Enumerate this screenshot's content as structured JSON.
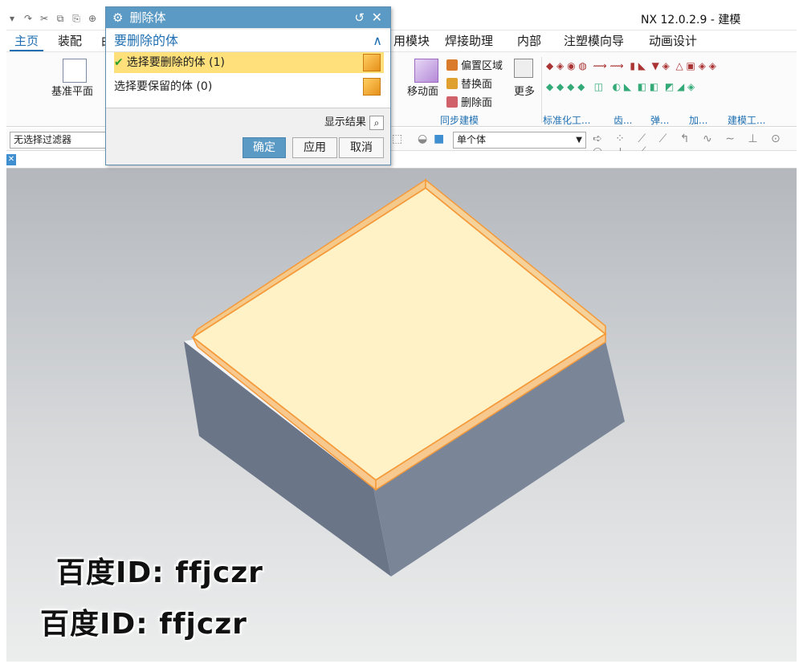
{
  "window": {
    "title": "NX 12.0.2.9 - 建模"
  },
  "tabs": [
    "主页",
    "装配",
    "曲",
    "用模块",
    "焊接助理",
    "内部",
    "注塑模向导",
    "动画设计"
  ],
  "ribbon": {
    "datum_plane": "基准平面",
    "move_face": "移动面",
    "offset_region": "偏置区域",
    "replace_face": "替换面",
    "delete_face": "删除面",
    "more": "更多",
    "sync_group": "同步建模",
    "group_standard": "标准化工...",
    "group_gear": "齿...",
    "group_spring": "弹...",
    "group_add": "加...",
    "group_modeling_tools": "建模工..."
  },
  "selection_bar": {
    "filter": "无选择过滤器",
    "scope": "单个体"
  },
  "dialog": {
    "title": "删除体",
    "section_title": "要删除的体",
    "select_delete": "选择要删除的体 (1)",
    "select_keep": "选择要保留的体 (0)",
    "show_result": "显示结果",
    "ok": "确定",
    "apply": "应用",
    "cancel": "取消"
  },
  "watermark": {
    "line1": "百度ID: ffjczr",
    "line2": "百度ID: ffjczr"
  },
  "colors": {
    "accent": "#5b9ac4",
    "selection_highlight": "#ffe07a",
    "body_face": "#6f7a8c"
  }
}
